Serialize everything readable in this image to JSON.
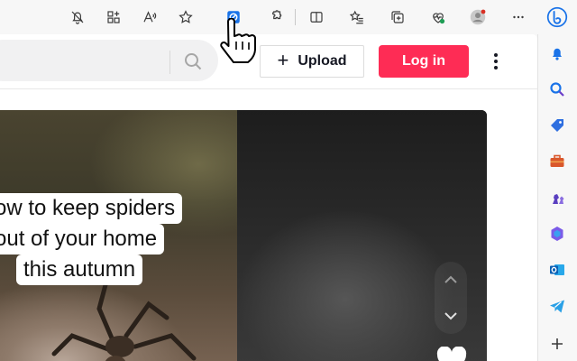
{
  "toolbar": {
    "icons": [
      "notifications-off-icon",
      "apps-icon",
      "read-aloud-icon",
      "favorite-star-icon",
      "extension-active-icon",
      "extensions-icon",
      "split-screen-icon",
      "favorites-icon",
      "collections-icon",
      "browser-essentials-icon",
      "profile-avatar-icon",
      "more-options-icon",
      "copilot-icon"
    ]
  },
  "header": {
    "upload_label": "Upload",
    "login_label": "Log in"
  },
  "video": {
    "caption_lines": [
      "ow to keep spiders",
      "out of your home",
      "this autumn"
    ]
  },
  "colors": {
    "brand_red": "#fe2c55",
    "upload_border": "#dcdcdc",
    "extension_blue": "#1a73e8"
  }
}
